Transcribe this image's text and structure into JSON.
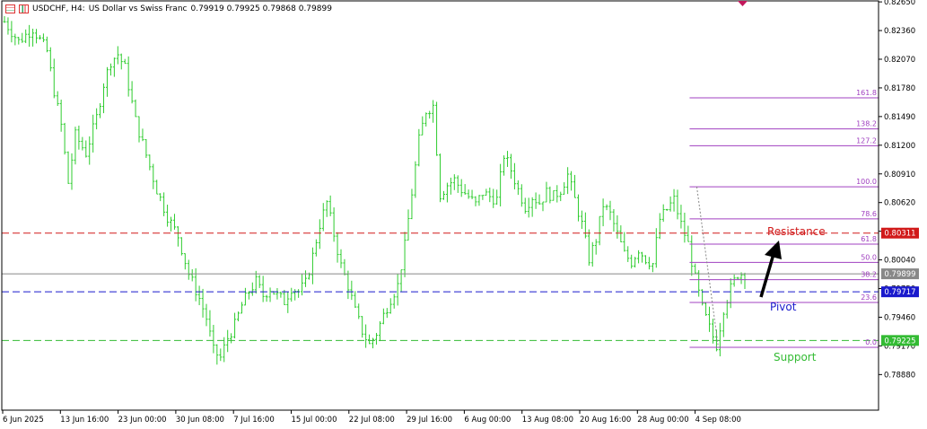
{
  "header": {
    "symbol": "USDCHF, H4:",
    "description": "US Dollar vs Swiss Franc",
    "ohlc": "0.79919 0.79925 0.79868 0.79899"
  },
  "colors": {
    "candle": "#2ecc2e",
    "resistance": "#d11a1a",
    "pivot": "#1a1acc",
    "support": "#33bb33",
    "fib": "#a040c0",
    "current": "#888888",
    "arrow": "#000000"
  },
  "labels": {
    "resistance": "Resistance",
    "pivot": "Pivot",
    "support": "Support"
  },
  "price_tags": {
    "resistance": "0.80311",
    "current": "0.79899",
    "pivot": "0.79717",
    "support": "0.79225"
  },
  "chart_data": {
    "type": "candlestick",
    "ylim": [
      0.7852,
      0.8266
    ],
    "y_ticks": [
      "0.82650",
      "0.82360",
      "0.82070",
      "0.81780",
      "0.81490",
      "0.81200",
      "0.80910",
      "0.80620",
      "0.80330",
      "0.80040",
      "0.79750",
      "0.79460",
      "0.79170",
      "0.78880"
    ],
    "x_ticks": [
      "6 Jun 2025",
      "13 Jun 16:00",
      "23 Jun 00:00",
      "30 Jun 08:00",
      "7 Jul 16:00",
      "15 Jul 00:00",
      "22 Jul 08:00",
      "29 Jul 16:00",
      "6 Aug 00:00",
      "13 Aug 08:00",
      "20 Aug 16:00",
      "28 Aug 00:00",
      "4 Sep 08:00"
    ],
    "close_path": [
      [
        0,
        0.8245
      ],
      [
        4,
        0.8225
      ],
      [
        8,
        0.8238
      ],
      [
        12,
        0.8215
      ],
      [
        14,
        0.8175
      ],
      [
        16,
        0.814
      ],
      [
        18,
        0.8082
      ],
      [
        20,
        0.813
      ],
      [
        23,
        0.8112
      ],
      [
        26,
        0.8148
      ],
      [
        28,
        0.8182
      ],
      [
        30,
        0.8205
      ],
      [
        32,
        0.8212
      ],
      [
        34,
        0.8198
      ],
      [
        37,
        0.8145
      ],
      [
        40,
        0.811
      ],
      [
        43,
        0.8075
      ],
      [
        46,
        0.8048
      ],
      [
        49,
        0.8028
      ],
      [
        52,
        0.799
      ],
      [
        55,
        0.7965
      ],
      [
        57,
        0.7945
      ],
      [
        59,
        0.7912
      ],
      [
        61,
        0.7905
      ],
      [
        63,
        0.7925
      ],
      [
        65,
        0.7938
      ],
      [
        67,
        0.7958
      ],
      [
        69,
        0.7972
      ],
      [
        71,
        0.7982
      ],
      [
        73,
        0.7968
      ],
      [
        75,
        0.7975
      ],
      [
        77,
        0.7968
      ],
      [
        79,
        0.7962
      ],
      [
        81,
        0.7976
      ],
      [
        83,
        0.7972
      ],
      [
        85,
        0.798
      ],
      [
        87,
        0.8008
      ],
      [
        89,
        0.804
      ],
      [
        91,
        0.8062
      ],
      [
        93,
        0.803
      ],
      [
        95,
        0.7998
      ],
      [
        97,
        0.7978
      ],
      [
        99,
        0.7952
      ],
      [
        101,
        0.7932
      ],
      [
        103,
        0.7918
      ],
      [
        105,
        0.793
      ],
      [
        107,
        0.7948
      ],
      [
        109,
        0.7965
      ],
      [
        111,
        0.7978
      ],
      [
        113,
        0.8018
      ],
      [
        115,
        0.8072
      ],
      [
        117,
        0.8125
      ],
      [
        119,
        0.8155
      ],
      [
        121,
        0.816
      ],
      [
        123,
        0.807
      ],
      [
        125,
        0.808
      ],
      [
        127,
        0.8085
      ],
      [
        129,
        0.8075
      ],
      [
        131,
        0.8068
      ],
      [
        133,
        0.806
      ],
      [
        135,
        0.8072
      ],
      [
        137,
        0.8068
      ],
      [
        139,
        0.8065
      ],
      [
        141,
        0.811
      ],
      [
        143,
        0.8095
      ],
      [
        145,
        0.8075
      ],
      [
        147,
        0.8058
      ],
      [
        149,
        0.8068
      ],
      [
        151,
        0.8062
      ],
      [
        153,
        0.8072
      ],
      [
        155,
        0.8068
      ],
      [
        157,
        0.8075
      ],
      [
        159,
        0.809
      ],
      [
        161,
        0.8065
      ],
      [
        163,
        0.804
      ],
      [
        165,
        0.8005
      ],
      [
        167,
        0.8025
      ],
      [
        169,
        0.806
      ],
      [
        171,
        0.805
      ],
      [
        173,
        0.803
      ],
      [
        175,
        0.801
      ],
      [
        177,
        0.8002
      ],
      [
        179,
        0.8015
      ],
      [
        181,
        0.8005
      ],
      [
        183,
        0.8
      ],
      [
        185,
        0.8045
      ],
      [
        187,
        0.8055
      ],
      [
        189,
        0.8065
      ],
      [
        191,
        0.804
      ],
      [
        193,
        0.802
      ],
      [
        195,
        0.7985
      ],
      [
        197,
        0.7955
      ],
      [
        199,
        0.7935
      ],
      [
        201,
        0.7918
      ],
      [
        203,
        0.7955
      ],
      [
        205,
        0.7975
      ],
      [
        207,
        0.799
      ],
      [
        209,
        0.799
      ]
    ],
    "n_candles": 210,
    "levels": [
      {
        "name": "resistance",
        "value": 0.80311,
        "style": "dash"
      },
      {
        "name": "pivot",
        "value": 0.79717,
        "style": "dash"
      },
      {
        "name": "support",
        "value": 0.79225,
        "style": "dash"
      },
      {
        "name": "current",
        "value": 0.79899,
        "style": "solid"
      }
    ],
    "fib": {
      "x_start": 0.7845,
      "levels": [
        {
          "label": "161.8",
          "value": 0.8168
        },
        {
          "label": "138.2",
          "value": 0.81365
        },
        {
          "label": "127.2",
          "value": 0.81195
        },
        {
          "label": "100.0",
          "value": 0.8078
        },
        {
          "label": "78.6",
          "value": 0.80455
        },
        {
          "label": "61.8",
          "value": 0.802
        },
        {
          "label": "50.0",
          "value": 0.80015
        },
        {
          "label": "38.2",
          "value": 0.7984
        },
        {
          "label": "23.6",
          "value": 0.7961
        },
        {
          "label": "0.0",
          "value": 0.79155
        }
      ]
    }
  }
}
